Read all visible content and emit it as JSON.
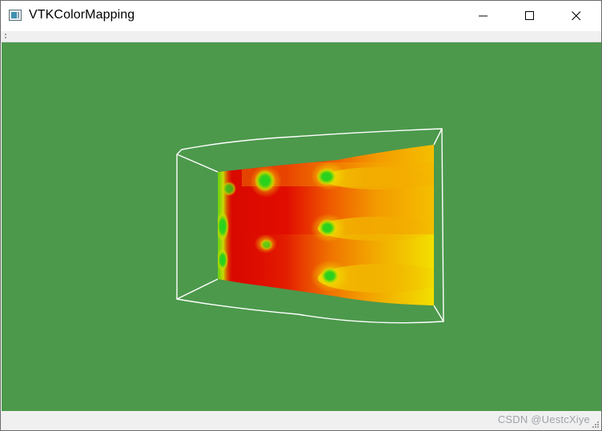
{
  "window": {
    "title": "VTKColorMapping",
    "app_icon": "vtk-app-icon",
    "controls": {
      "minimize_icon": "minimize-icon",
      "maximize_icon": "maximize-icon",
      "close_icon": "close-icon"
    }
  },
  "viewport": {
    "background_color": "#4c994c",
    "outline_color": "#ffffff",
    "colormap": [
      "#dd0000",
      "#ee5500",
      "#f39a00",
      "#f2e100",
      "#22dd22"
    ]
  },
  "watermark": {
    "text": "CSDN @UestcXiye"
  }
}
